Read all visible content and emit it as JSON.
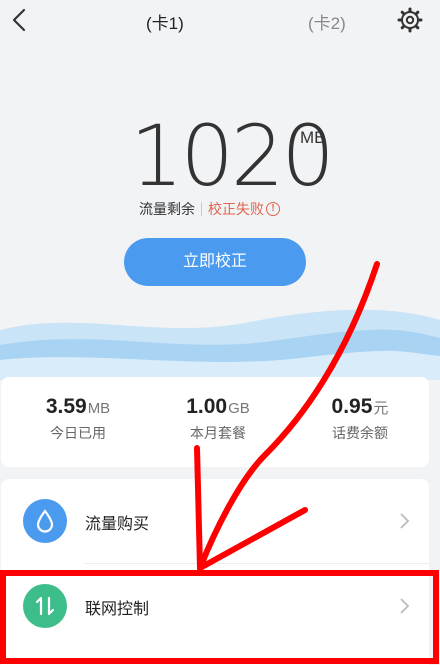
{
  "header": {
    "tab_sim1": "(卡1)",
    "tab_sim2": "(卡2)"
  },
  "data_remaining": {
    "value": "1020",
    "unit": "MB",
    "label": "流量剩余",
    "status": "校正失败",
    "status_icon": "!"
  },
  "calibrate_button": "立即校正",
  "stats": [
    {
      "value": "3.59",
      "unit": "MB",
      "label": "今日已用"
    },
    {
      "value": "1.00",
      "unit": "GB",
      "label": "本月套餐"
    },
    {
      "value": "0.95",
      "unit": "元",
      "label": "话费余额"
    }
  ],
  "menu": [
    {
      "label": "流量购买",
      "icon": "water-drop-icon",
      "color": "#4a9bef"
    },
    {
      "label": "联网控制",
      "icon": "up-down-arrows-icon",
      "color": "#3dbd8a"
    }
  ],
  "colors": {
    "accent": "#4a9bef",
    "error": "#e2644c",
    "annotation": "#ff0000"
  }
}
